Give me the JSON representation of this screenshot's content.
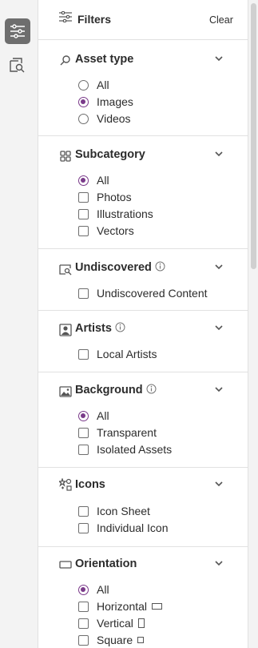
{
  "rail": {
    "filters_icon": "sliders-icon",
    "search_icon": "document-search-icon"
  },
  "header": {
    "title": "Filters",
    "clear_label": "Clear"
  },
  "sections": {
    "asset_type": {
      "title": "Asset type",
      "options": [
        "All",
        "Images",
        "Videos"
      ],
      "selected": "Images"
    },
    "subcategory": {
      "title": "Subcategory",
      "options": [
        "All",
        "Photos",
        "Illustrations",
        "Vectors"
      ],
      "selected": "All"
    },
    "undiscovered": {
      "title": "Undiscovered",
      "options": [
        "Undiscovered Content"
      ]
    },
    "artists": {
      "title": "Artists",
      "options": [
        "Local Artists"
      ]
    },
    "background": {
      "title": "Background",
      "options": [
        "All",
        "Transparent",
        "Isolated Assets"
      ],
      "selected": "All"
    },
    "icons": {
      "title": "Icons",
      "options": [
        "Icon Sheet",
        "Individual Icon"
      ]
    },
    "orientation": {
      "title": "Orientation",
      "options": [
        "All",
        "Horizontal",
        "Vertical",
        "Square"
      ],
      "selected": "All"
    }
  },
  "colors": {
    "accent": "#7a3a8a",
    "rail_active": "#6e6e6e"
  }
}
